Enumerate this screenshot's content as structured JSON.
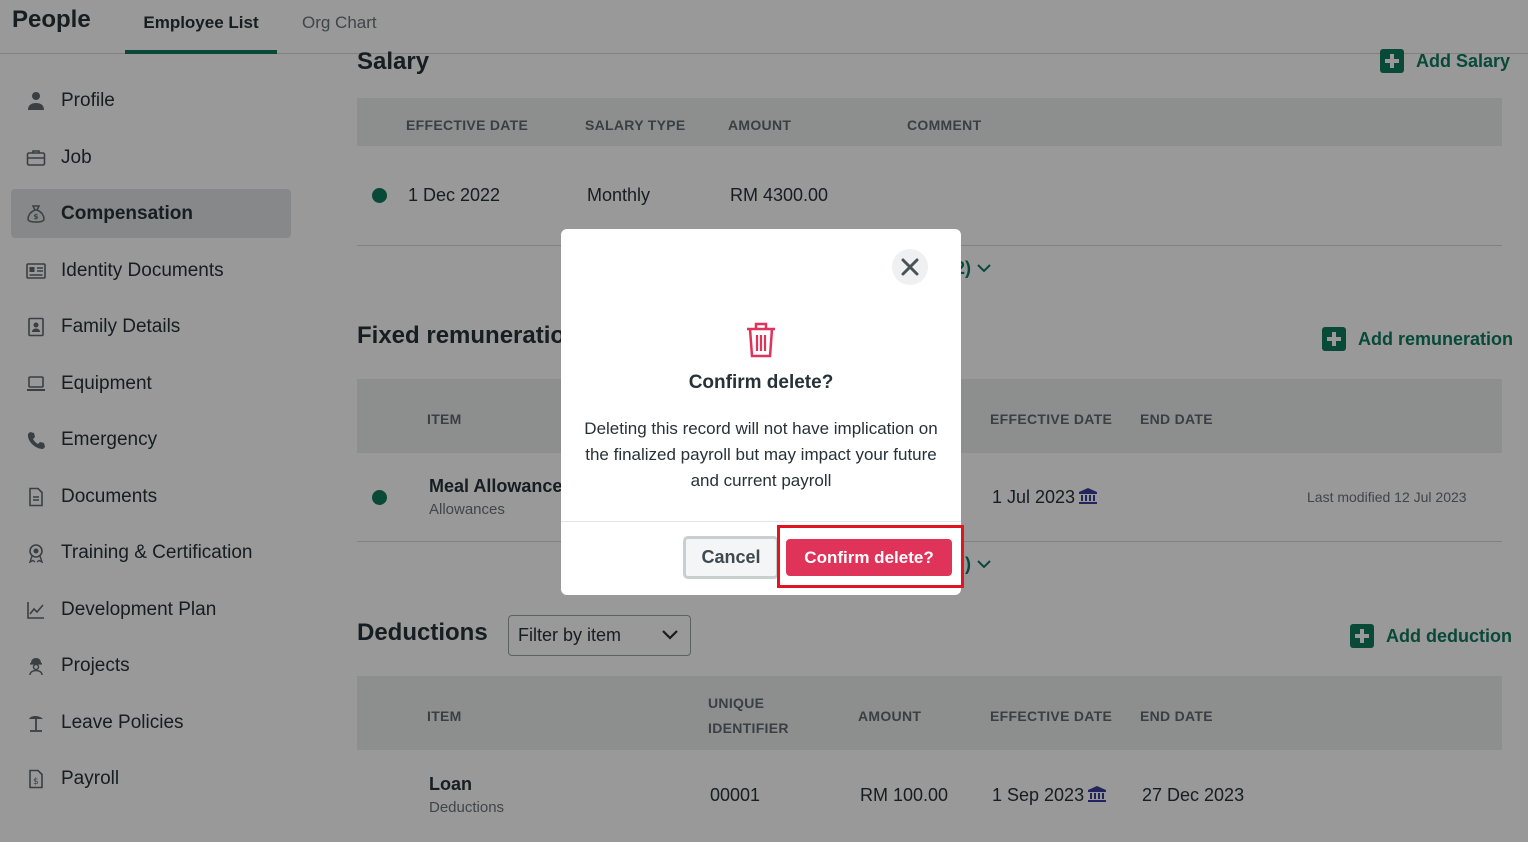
{
  "app": {
    "title": "People"
  },
  "tabs": [
    {
      "label": "Employee List",
      "active": true
    },
    {
      "label": "Org Chart",
      "active": false
    }
  ],
  "sidebar": {
    "items": [
      {
        "label": "Profile",
        "icon": "person-icon"
      },
      {
        "label": "Job",
        "icon": "briefcase-icon"
      },
      {
        "label": "Compensation",
        "icon": "money-bag-icon",
        "active": true
      },
      {
        "label": "Identity Documents",
        "icon": "id-card-icon"
      },
      {
        "label": "Family Details",
        "icon": "family-icon"
      },
      {
        "label": "Equipment",
        "icon": "laptop-icon"
      },
      {
        "label": "Emergency",
        "icon": "phone-icon"
      },
      {
        "label": "Documents",
        "icon": "document-icon"
      },
      {
        "label": "Training & Certification",
        "icon": "badge-icon"
      },
      {
        "label": "Development Plan",
        "icon": "chart-icon"
      },
      {
        "label": "Projects",
        "icon": "worker-icon"
      },
      {
        "label": "Leave Policies",
        "icon": "beach-icon"
      },
      {
        "label": "Payroll",
        "icon": "payroll-icon"
      }
    ]
  },
  "salary": {
    "title": "Salary",
    "add_label": "Add Salary",
    "columns": [
      "EFFECTIVE DATE",
      "SALARY TYPE",
      "AMOUNT",
      "COMMENT"
    ],
    "row": {
      "effective_date": "1 Dec 2022",
      "salary_type": "Monthly",
      "amount": "RM 4300.00"
    },
    "expand_label": "2)"
  },
  "remuneration": {
    "title": "Fixed remuneratio",
    "add_label": "Add remuneration",
    "columns": [
      "ITEM",
      "EFFECTIVE DATE",
      "END DATE"
    ],
    "row": {
      "item": "Meal Allowance",
      "category": "Allowances",
      "effective_date": "1 Jul 2023",
      "last_modified": "Last modified 12 Jul 2023"
    },
    "expand_label": ")"
  },
  "deductions": {
    "title": "Deductions",
    "add_label": "Add deduction",
    "filter_placeholder": "Filter by item",
    "columns": [
      "ITEM",
      "UNIQUE",
      "IDENTIFIER",
      "AMOUNT",
      "EFFECTIVE DATE",
      "END DATE"
    ],
    "row": {
      "item": "Loan",
      "category": "Deductions",
      "identifier": "00001",
      "amount": "RM 100.00",
      "effective_date": "1 Sep 2023",
      "end_date": "27 Dec 2023"
    }
  },
  "modal": {
    "title": "Confirm delete?",
    "message": "Deleting this record will not have implication on the finalized payroll but may impact your future and current payroll",
    "cancel_label": "Cancel",
    "confirm_label": "Confirm delete?"
  },
  "colors": {
    "accent": "#0e7a5c",
    "danger": "#e0335a",
    "highlight": "#e2141f"
  }
}
